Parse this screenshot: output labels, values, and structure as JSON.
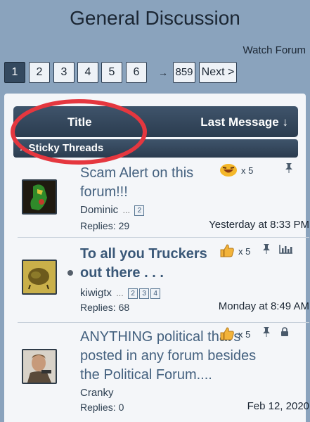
{
  "page": {
    "title": "General Discussion",
    "watch_label": "Watch Forum"
  },
  "pager": {
    "pages": [
      "1",
      "2",
      "3",
      "4",
      "5",
      "6"
    ],
    "arrow": "→",
    "last": "859",
    "next_label": "Next >"
  },
  "table": {
    "col_title": "Title",
    "col_last": "Last Message ↓",
    "sticky_label": "» Sticky Threads"
  },
  "threads": [
    {
      "title": "Scam Alert on this forum!!!",
      "author": "Dominic",
      "pages": [
        "2"
      ],
      "replies_label": "Replies:",
      "replies": "29",
      "last": "Yesterday at 8:33 PM",
      "reaction_count": "x 5",
      "reaction_icon": "laughing-emoji-icon"
    },
    {
      "title": "To all you Truckers out there . . .",
      "author": "kiwigtx",
      "pages": [
        "2",
        "3",
        "4"
      ],
      "replies_label": "Replies:",
      "replies": "68",
      "last": "Monday at 8:49 AM",
      "reaction_count": "x 5",
      "reaction_icon": "thumbs-up-icon"
    },
    {
      "title": "ANYTHING political that's posted in any forum besides the Political Forum....",
      "author": "Cranky",
      "pages": [],
      "replies_label": "Replies:",
      "replies": "0",
      "last": "Feb 12, 2020",
      "reaction_count": "x 5",
      "reaction_icon": "thumbs-up-icon"
    }
  ],
  "colors": {
    "background": "#8aa3bd",
    "header": "#34495f",
    "annotation": "#e5373f",
    "link": "#44617f"
  }
}
